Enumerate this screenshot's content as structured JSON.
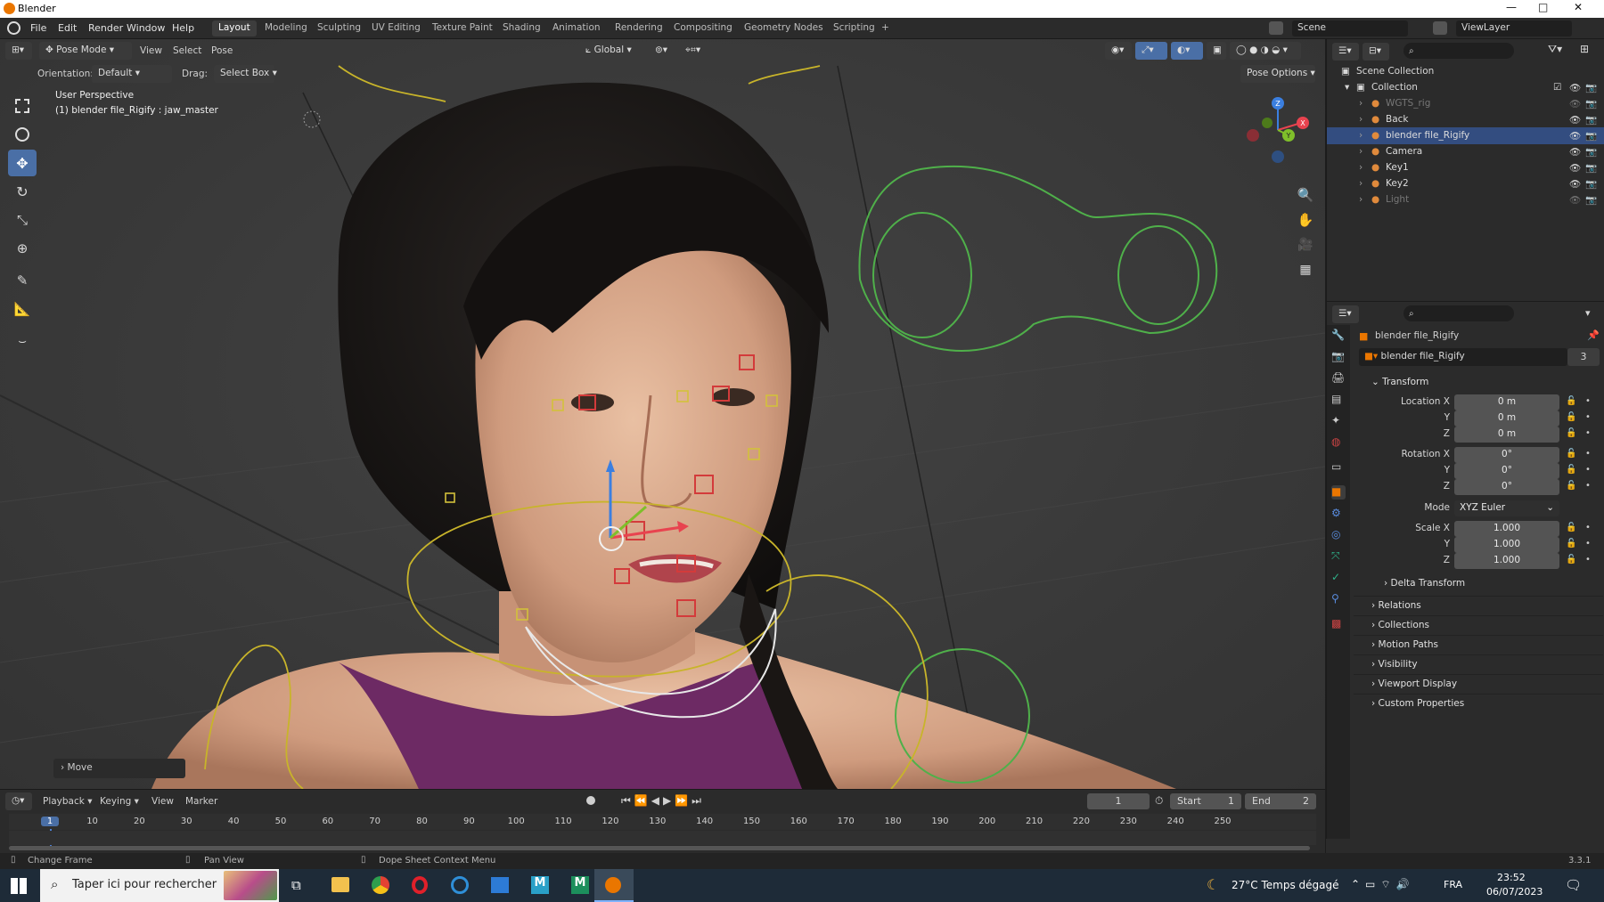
{
  "window": {
    "title": "Blender",
    "controls": [
      "—",
      "□",
      "✕"
    ]
  },
  "menu": {
    "items": [
      "File",
      "Edit",
      "Render",
      "Window",
      "Help"
    ]
  },
  "workspaces": [
    "Layout",
    "Modeling",
    "Sculpting",
    "UV Editing",
    "Texture Paint",
    "Shading",
    "Animation",
    "Rendering",
    "Compositing",
    "Geometry Nodes",
    "Scripting",
    "+"
  ],
  "active_workspace": "Layout",
  "scene": {
    "label": "Scene",
    "viewlayer": "ViewLayer"
  },
  "viewport": {
    "mode": "Pose Mode",
    "menus": [
      "View",
      "Select",
      "Pose"
    ],
    "transform_orientation": "Global",
    "orientation_label": "Orientation:",
    "orientation_value": "Default",
    "drag_label": "Drag:",
    "drag_value": "Select Box",
    "pose_options": "Pose Options",
    "overlay_line1": "User Perspective",
    "overlay_line2": "(1) blender file_Rigify : jaw_master",
    "last_op": "Move",
    "gizmo_axes": {
      "x": "X",
      "y": "Y",
      "z": "Z"
    }
  },
  "outliner": {
    "root": "Scene Collection",
    "collection": "Collection",
    "items": [
      {
        "name": "WGTS_rig",
        "dim": true
      },
      {
        "name": "Back",
        "dim": false
      },
      {
        "name": "blender file_Rigify",
        "dim": false,
        "selected": true
      },
      {
        "name": "Camera",
        "dim": false
      },
      {
        "name": "Key1",
        "dim": false
      },
      {
        "name": "Key2",
        "dim": false
      },
      {
        "name": "Light",
        "dim": true
      }
    ]
  },
  "properties": {
    "object_name": "blender file_Rigify",
    "data_name": "blender file_Rigify",
    "users": "3",
    "transform_header": "Transform",
    "location": {
      "label": "Location X",
      "x": "0 m",
      "y": "0 m",
      "z": "0 m"
    },
    "rotation": {
      "label": "Rotation X",
      "x": "0°",
      "y": "0°",
      "z": "0°"
    },
    "mode_label": "Mode",
    "mode_value": "XYZ Euler",
    "scale": {
      "label": "Scale X",
      "x": "1.000",
      "y": "1.000",
      "z": "1.000"
    },
    "axis_y": "Y",
    "axis_z": "Z",
    "delta": "Delta Transform",
    "panels": [
      "Relations",
      "Collections",
      "Motion Paths",
      "Visibility",
      "Viewport Display",
      "Custom Properties"
    ]
  },
  "timeline": {
    "menus": [
      "Playback",
      "Keying",
      "View",
      "Marker"
    ],
    "current_frame": "1",
    "start_label": "Start",
    "start": "1",
    "end_label": "End",
    "end": "2",
    "ticks": [
      "1",
      "10",
      "20",
      "30",
      "40",
      "50",
      "60",
      "70",
      "80",
      "90",
      "100",
      "110",
      "120",
      "130",
      "140",
      "150",
      "160",
      "170",
      "180",
      "190",
      "200",
      "210",
      "220",
      "230",
      "240",
      "250"
    ]
  },
  "status": {
    "left": "Change Frame",
    "middle": "Pan View",
    "right": "Dope Sheet Context Menu",
    "version": "3.3.1"
  },
  "taskbar": {
    "search": "Taper ici pour rechercher",
    "weather": "27°C  Temps dégagé",
    "lang": "FRA",
    "time": "23:52",
    "date": "06/07/2023"
  },
  "colors": {
    "accent": "#4a6fa6",
    "selection": "#334d80",
    "rig_green": "#4fb04a",
    "rig_yellow": "#c8b42a",
    "x_axis": "#e8434f",
    "y_axis": "#7fbf2a",
    "z_axis": "#3b7fe0"
  }
}
